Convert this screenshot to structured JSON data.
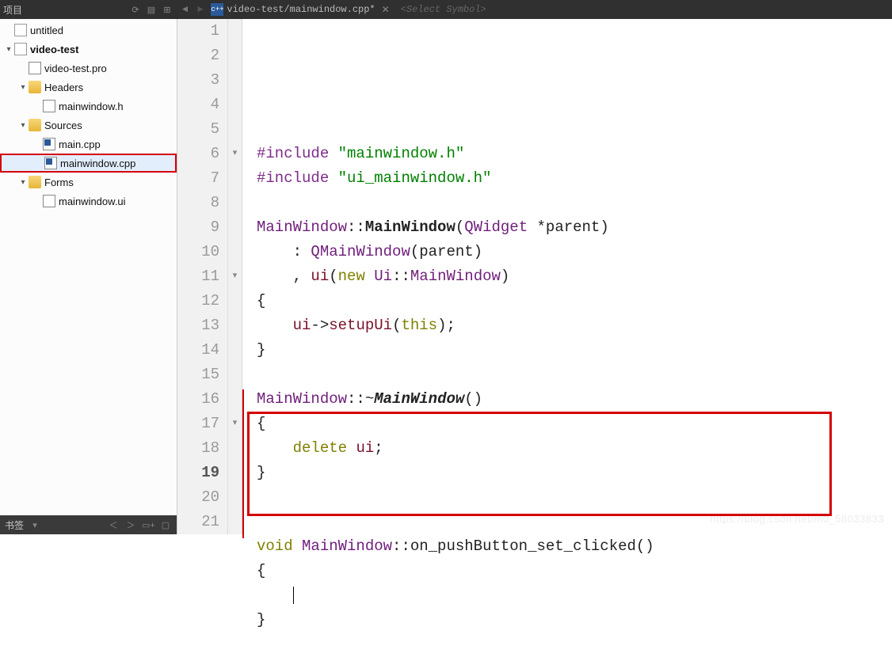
{
  "topbar": {
    "panel_label": "项目",
    "path_prefix": "video-test/mainwindow.cpp*",
    "symbol_select": "<Select Symbol>",
    "close_x": "✕"
  },
  "tree": {
    "items": [
      {
        "depth": 0,
        "twisty": "",
        "icon": "project",
        "label": "untitled",
        "bold": false
      },
      {
        "depth": 0,
        "twisty": "▾",
        "icon": "project",
        "label": "video-test",
        "bold": true
      },
      {
        "depth": 1,
        "twisty": "",
        "icon": "file-pro",
        "label": "video-test.pro",
        "bold": false
      },
      {
        "depth": 1,
        "twisty": "▾",
        "icon": "folder-h",
        "label": "Headers",
        "bold": false
      },
      {
        "depth": 2,
        "twisty": "",
        "icon": "file-h",
        "label": "mainwindow.h",
        "bold": false
      },
      {
        "depth": 1,
        "twisty": "▾",
        "icon": "folder",
        "label": "Sources",
        "bold": false
      },
      {
        "depth": 2,
        "twisty": "",
        "icon": "file-cpp",
        "label": "main.cpp",
        "bold": false
      },
      {
        "depth": 2,
        "twisty": "",
        "icon": "file-cpp",
        "label": "mainwindow.cpp",
        "bold": false,
        "selected": true
      },
      {
        "depth": 1,
        "twisty": "▾",
        "icon": "folder",
        "label": "Forms",
        "bold": false
      },
      {
        "depth": 2,
        "twisty": "",
        "icon": "file-ui",
        "label": "mainwindow.ui",
        "bold": false
      }
    ]
  },
  "bookmark": {
    "label": "书签"
  },
  "editor": {
    "lines": [
      {
        "n": 1,
        "fold": "",
        "html": "<span class='tok-pre'>#include</span> <span class='tok-str'>\"mainwindow.h\"</span>"
      },
      {
        "n": 2,
        "fold": "",
        "html": "<span class='tok-pre'>#include</span> <span class='tok-str'>\"ui_mainwindow.h\"</span>"
      },
      {
        "n": 3,
        "fold": "",
        "html": ""
      },
      {
        "n": 4,
        "fold": "",
        "html": "<span class='tok-type'>MainWindow</span>::<span class='tok-func'>MainWindow</span>(<span class='tok-type'>QWidget</span> *parent)"
      },
      {
        "n": 5,
        "fold": "",
        "html": "    : <span class='tok-type'>QMainWindow</span>(parent)"
      },
      {
        "n": 6,
        "fold": "▾",
        "html": "    , <span class='tok-ui'>ui</span>(<span class='tok-kw'>new</span> <span class='tok-type'>Ui</span>::<span class='tok-type'>MainWindow</span>)"
      },
      {
        "n": 7,
        "fold": "",
        "html": "{"
      },
      {
        "n": 8,
        "fold": "",
        "html": "    <span class='tok-ui'>ui</span>-&gt;<span class='tok-member'>setupUi</span>(<span class='tok-this'>this</span>);"
      },
      {
        "n": 9,
        "fold": "",
        "html": "}"
      },
      {
        "n": 10,
        "fold": "",
        "html": ""
      },
      {
        "n": 11,
        "fold": "▾",
        "html": "<span class='tok-type'>MainWindow</span>::~<span class='tok-funcI'>MainWindow</span>()"
      },
      {
        "n": 12,
        "fold": "",
        "html": "{"
      },
      {
        "n": 13,
        "fold": "",
        "html": "    <span class='tok-kw'>delete</span> <span class='tok-ui'>ui</span>;"
      },
      {
        "n": 14,
        "fold": "",
        "html": "}"
      },
      {
        "n": 15,
        "fold": "",
        "html": ""
      },
      {
        "n": 16,
        "fold": "",
        "html": ""
      },
      {
        "n": 17,
        "fold": "▾",
        "html": "<span class='tok-void'>void</span> <span class='tok-type'>MainWindow</span>::on_pushButton_set_clicked()"
      },
      {
        "n": 18,
        "fold": "",
        "html": "{"
      },
      {
        "n": 19,
        "fold": "",
        "bold": true,
        "html": "    <span class='cursor-caret'></span>"
      },
      {
        "n": 20,
        "fold": "",
        "html": "}"
      },
      {
        "n": 21,
        "fold": "",
        "html": ""
      }
    ]
  },
  "watermark": "https://blog.csdn.net/m0_58033833"
}
